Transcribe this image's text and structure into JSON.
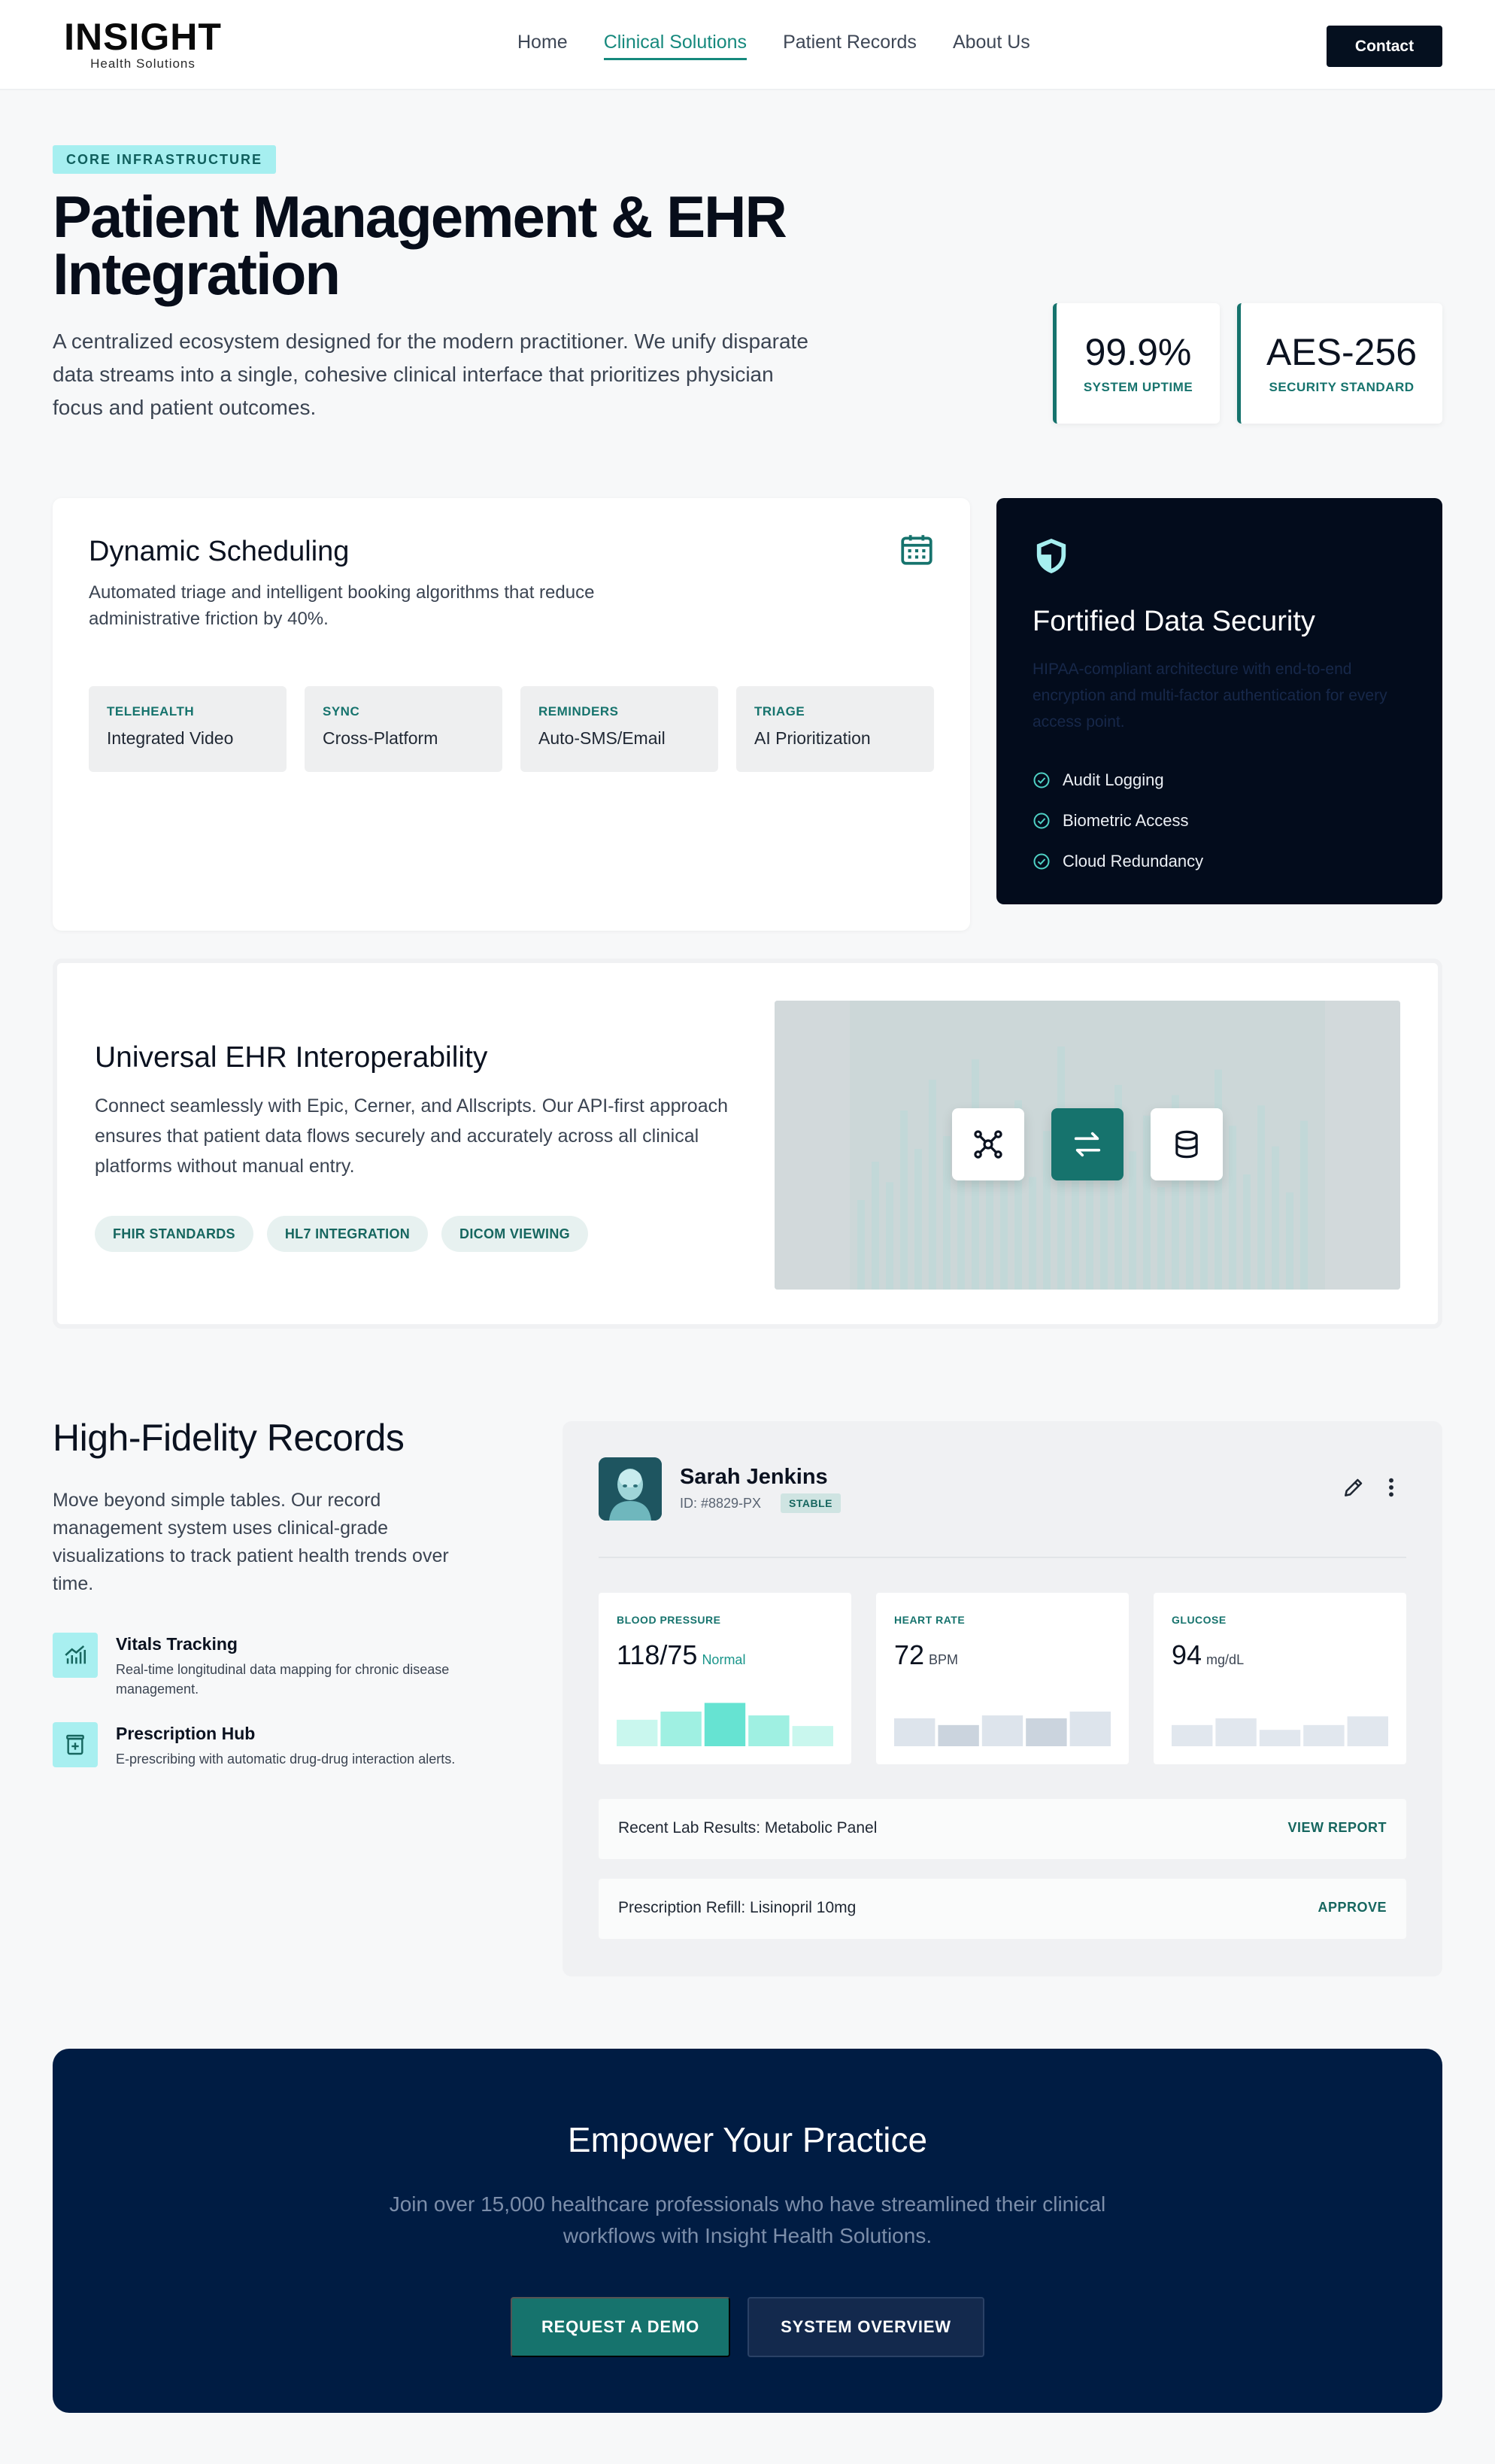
{
  "header": {
    "logo_main": "INSIGHT",
    "logo_sub": "Health Solutions",
    "nav": [
      "Home",
      "Clinical Solutions",
      "Patient Records",
      "About Us"
    ],
    "nav_active": "Clinical Solutions",
    "contact_label": "Contact"
  },
  "hero": {
    "badge": "CORE INFRASTRUCTURE",
    "title_line1": "Patient Management & EHR",
    "title_line2": "Integration",
    "description": "A centralized ecosystem designed for the modern practitioner. We unify disparate data streams into a single, cohesive clinical interface that prioritizes physician focus and patient outcomes.",
    "stats": [
      {
        "value": "99.9%",
        "label": "SYSTEM UPTIME"
      },
      {
        "value": "AES-256",
        "label": "SECURITY STANDARD"
      }
    ]
  },
  "scheduling": {
    "title": "Dynamic Scheduling",
    "icon": "calendar-icon",
    "description": "Automated triage and intelligent booking algorithms that reduce administrative friction by 40%.",
    "chips": [
      {
        "label": "TELEHEALTH",
        "value": "Integrated Video"
      },
      {
        "label": "SYNC",
        "value": "Cross-Platform"
      },
      {
        "label": "REMINDERS",
        "value": "Auto-SMS/Email"
      },
      {
        "label": "TRIAGE",
        "value": "AI Prioritization"
      }
    ]
  },
  "security": {
    "icon": "shield-icon",
    "title": "Fortified Data Security",
    "description": "HIPAA-compliant architecture with end-to-end encryption and multi-factor authentication for every access point.",
    "items": [
      "Audit Logging",
      "Biometric Access",
      "Cloud Redundancy"
    ]
  },
  "interop": {
    "title": "Universal EHR Interoperability",
    "description": "Connect seamlessly with Epic, Cerner, and Allscripts. Our API-first approach ensures that patient data flows securely and accurately across all clinical platforms without manual entry.",
    "pills": [
      "FHIR STANDARDS",
      "HL7 INTEGRATION",
      "DICOM VIEWING"
    ],
    "icons": [
      "network-icon",
      "swap-icon",
      "database-icon"
    ]
  },
  "records": {
    "title": "High-Fidelity Records",
    "description": "Move beyond simple tables. Our record management system uses clinical-grade visualizations to track patient health trends over time.",
    "features": [
      {
        "icon": "chart-icon",
        "title": "Vitals Tracking",
        "description": "Real-time longitudinal data mapping for chronic disease management."
      },
      {
        "icon": "prescription-icon",
        "title": "Prescription Hub",
        "description": "E-prescribing with automatic drug-drug interaction alerts."
      }
    ]
  },
  "patient": {
    "name": "Sarah Jenkins",
    "id": "ID: #8829-PX",
    "status": "STABLE",
    "vitals": [
      {
        "label": "BLOOD PRESSURE",
        "value": "118/75",
        "unit": "Normal",
        "levels": [
          0.55,
          0.72,
          0.9,
          0.64,
          0.42
        ]
      },
      {
        "label": "HEART RATE",
        "value": "72",
        "unit": "BPM",
        "levels": [
          0.58,
          0.44,
          0.64,
          0.58,
          0.72
        ]
      },
      {
        "label": "GLUCOSE",
        "value": "94",
        "unit": "mg/dL",
        "levels": [
          0.44,
          0.58,
          0.34,
          0.44,
          0.62
        ]
      }
    ],
    "rows": [
      {
        "text": "Recent Lab Results: Metabolic Panel",
        "action": "VIEW REPORT"
      },
      {
        "text": "Prescription Refill: Lisinopril 10mg",
        "action": "APPROVE"
      }
    ]
  },
  "cta": {
    "title": "Empower Your Practice",
    "description": "Join over 15,000 healthcare professionals who have streamlined their clinical workflows with Insight Health Solutions.",
    "primary": "REQUEST A DEMO",
    "secondary": "SYSTEM OVERVIEW"
  },
  "colors": {
    "accent": "#16736d",
    "navy": "#001c43",
    "dark": "#030c1c",
    "aqua": "#a6eff0"
  }
}
